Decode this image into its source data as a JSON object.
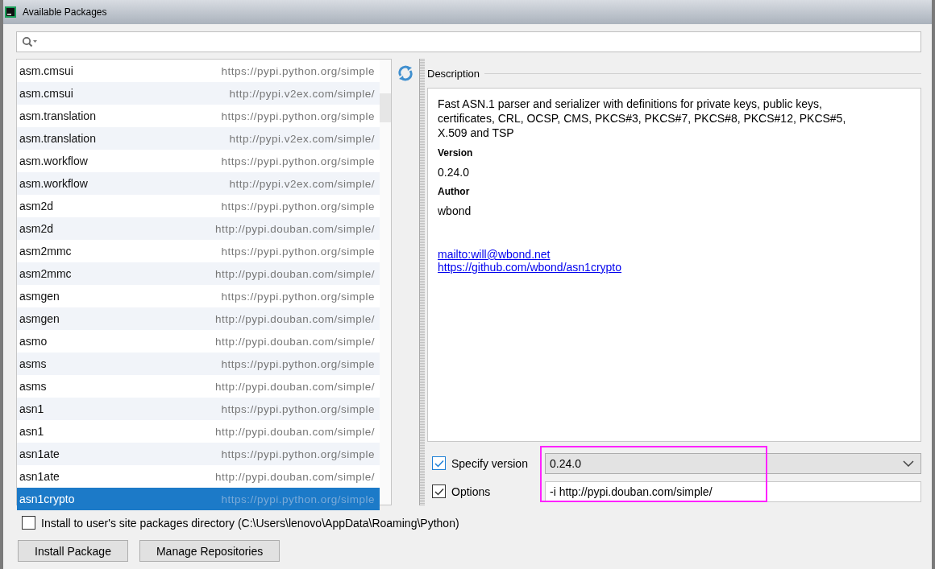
{
  "window": {
    "title": "Available Packages"
  },
  "packages": [
    {
      "name": "asm.cmsui",
      "repository": "https://pypi.python.org/simple",
      "selected": false
    },
    {
      "name": "asm.cmsui",
      "repository": "http://pypi.v2ex.com/simple/",
      "selected": false
    },
    {
      "name": "asm.translation",
      "repository": "https://pypi.python.org/simple",
      "selected": false
    },
    {
      "name": "asm.translation",
      "repository": "http://pypi.v2ex.com/simple/",
      "selected": false
    },
    {
      "name": "asm.workflow",
      "repository": "https://pypi.python.org/simple",
      "selected": false
    },
    {
      "name": "asm.workflow",
      "repository": "http://pypi.v2ex.com/simple/",
      "selected": false
    },
    {
      "name": "asm2d",
      "repository": "https://pypi.python.org/simple",
      "selected": false
    },
    {
      "name": "asm2d",
      "repository": "http://pypi.douban.com/simple/",
      "selected": false
    },
    {
      "name": "asm2mmc",
      "repository": "https://pypi.python.org/simple",
      "selected": false
    },
    {
      "name": "asm2mmc",
      "repository": "http://pypi.douban.com/simple/",
      "selected": false
    },
    {
      "name": "asmgen",
      "repository": "https://pypi.python.org/simple",
      "selected": false
    },
    {
      "name": "asmgen",
      "repository": "http://pypi.douban.com/simple/",
      "selected": false
    },
    {
      "name": "asmo",
      "repository": "http://pypi.douban.com/simple/",
      "selected": false
    },
    {
      "name": "asms",
      "repository": "https://pypi.python.org/simple",
      "selected": false
    },
    {
      "name": "asms",
      "repository": "http://pypi.douban.com/simple/",
      "selected": false
    },
    {
      "name": "asn1",
      "repository": "https://pypi.python.org/simple",
      "selected": false
    },
    {
      "name": "asn1",
      "repository": "http://pypi.douban.com/simple/",
      "selected": false
    },
    {
      "name": "asn1ate",
      "repository": "https://pypi.python.org/simple",
      "selected": false
    },
    {
      "name": "asn1ate",
      "repository": "http://pypi.douban.com/simple/",
      "selected": false
    },
    {
      "name": "asn1crypto",
      "repository": "https://pypi.python.org/simple",
      "selected": true
    }
  ],
  "description": {
    "heading": "Description",
    "summary": "Fast ASN.1 parser and serializer with definitions for private keys, public keys, certificates, CRL, OCSP, CMS, PKCS#3, PKCS#7, PKCS#8, PKCS#12, PKCS#5, X.509 and TSP",
    "version_label": "Version",
    "version": "0.24.0",
    "author_label": "Author",
    "author": "wbond",
    "links": [
      "mailto:will@wbond.net",
      "https://github.com/wbond/asn1crypto"
    ]
  },
  "specify_version": {
    "label": "Specify version",
    "checked": true,
    "value": "0.24.0"
  },
  "options": {
    "label": "Options",
    "checked": true,
    "value": "-i http://pypi.douban.com/simple/"
  },
  "install_to_user": {
    "label": "Install to user's site packages directory (C:\\Users\\lenovo\\AppData\\Roaming\\Python)",
    "checked": false
  },
  "buttons": [
    "Install Package",
    "Manage Repositories"
  ]
}
